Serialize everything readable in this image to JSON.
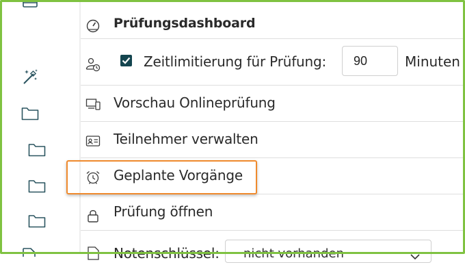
{
  "sidebar": {
    "icons": [
      "folder-icon",
      "magic-wand-icon",
      "folder-icon",
      "folder-icon",
      "folder-icon",
      "folder-icon",
      "document-icon"
    ]
  },
  "panel": {
    "dashboard_label": "Prüfungsdashboard",
    "time_limit": {
      "label": "Zeitlimitierung für Prüfung:",
      "checked": true,
      "minutes_value": "90",
      "minutes_unit": "Minuten"
    },
    "preview_label": "Vorschau Onlineprüfung",
    "participants_label": "Teilnehmer verwalten",
    "scheduled_label": "Geplante Vorgänge",
    "open_exam_label": "Prüfung öffnen",
    "grade_key": {
      "label": "Notenschlüssel:",
      "selected": "nicht vorhanden"
    }
  },
  "colors": {
    "frame": "#7fc241",
    "highlight": "#ef8a2d",
    "checkbox": "#14454f"
  }
}
